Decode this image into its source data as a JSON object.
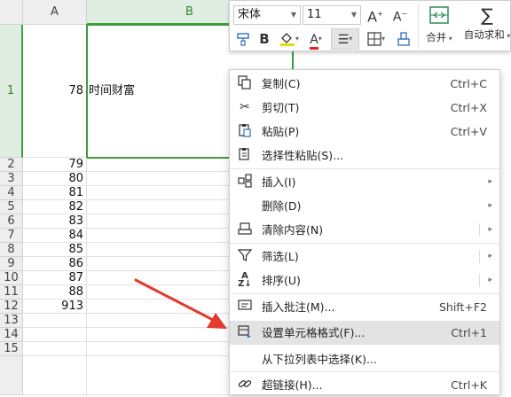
{
  "sheet": {
    "columns": [
      "A",
      "B"
    ],
    "rows": [
      {
        "n": "1",
        "a": "78",
        "b": "时间财富"
      },
      {
        "n": "2",
        "a": "79"
      },
      {
        "n": "3",
        "a": "80"
      },
      {
        "n": "4",
        "a": "81"
      },
      {
        "n": "5",
        "a": "82"
      },
      {
        "n": "6",
        "a": "83"
      },
      {
        "n": "7",
        "a": "84"
      },
      {
        "n": "8",
        "a": "85"
      },
      {
        "n": "9",
        "a": "86"
      },
      {
        "n": "10",
        "a": "87"
      },
      {
        "n": "11",
        "a": "88"
      },
      {
        "n": "12",
        "a": "913"
      },
      {
        "n": "13",
        "a": ""
      },
      {
        "n": "14",
        "a": ""
      },
      {
        "n": "15",
        "a": ""
      }
    ]
  },
  "toolbar": {
    "font_name": "宋体",
    "font_size": "11",
    "grow_font": "A",
    "shrink_font": "A",
    "bold": "B",
    "font_color_letter": "A",
    "merge_label": "合并",
    "autosum_label": "自动求和"
  },
  "menu": {
    "items": [
      {
        "label": "复制(C)",
        "shortcut": "Ctrl+C",
        "icon": "copy-icon"
      },
      {
        "label": "剪切(T)",
        "shortcut": "Ctrl+X",
        "icon": "scissors-icon"
      },
      {
        "label": "粘贴(P)",
        "shortcut": "Ctrl+V",
        "icon": "paste-icon"
      },
      {
        "label": "选择性粘贴(S)...",
        "shortcut": "",
        "icon": "paste-special-icon"
      },
      {
        "label": "插入(I)",
        "shortcut": "",
        "icon": "insert-icon"
      },
      {
        "label": "删除(D)",
        "shortcut": "",
        "icon": ""
      },
      {
        "label": "清除内容(N)",
        "shortcut": "",
        "icon": "eraser-icon"
      },
      {
        "label": "筛选(L)",
        "shortcut": "",
        "icon": "filter-icon"
      },
      {
        "label": "排序(U)",
        "shortcut": "",
        "icon": "sort-az-icon"
      },
      {
        "label": "插入批注(M)...",
        "shortcut": "Shift+F2",
        "icon": "comment-icon"
      },
      {
        "label": "设置单元格格式(F)...",
        "shortcut": "Ctrl+1",
        "icon": "format-cells-icon"
      },
      {
        "label": "从下拉列表中选择(K)...",
        "shortcut": "",
        "icon": ""
      },
      {
        "label": "超链接(H)...",
        "shortcut": "Ctrl+K",
        "icon": "link-icon"
      }
    ]
  },
  "colors": {
    "selection": "#3d9b3d",
    "annotation_arrow": "#e23b2e",
    "highlight": "#e3e3e3"
  }
}
